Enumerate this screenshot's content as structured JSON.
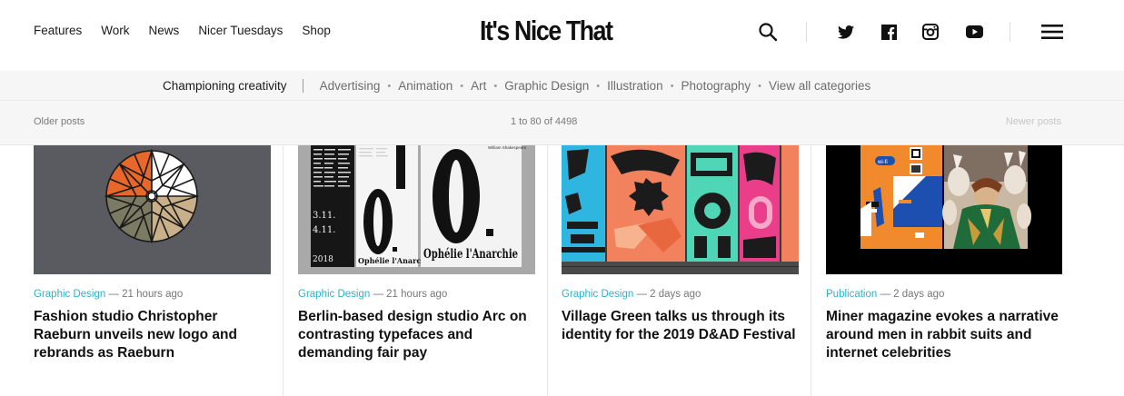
{
  "header": {
    "nav": [
      "Features",
      "Work",
      "News",
      "Nicer Tuesdays",
      "Shop"
    ],
    "logo": "It's Nice That",
    "icons": [
      "search-icon",
      "twitter-icon",
      "facebook-icon",
      "instagram-icon",
      "youtube-icon",
      "menu-icon"
    ]
  },
  "categories": {
    "tagline": "Championing creativity",
    "items": [
      "Advertising",
      "Animation",
      "Art",
      "Graphic Design",
      "Illustration",
      "Photography",
      "View all categories"
    ],
    "separator": "•"
  },
  "pagination": {
    "older": "Older posts",
    "count": "1 to 80 of 4498",
    "newer": "Newer posts"
  },
  "cards": [
    {
      "category": "Graphic Design",
      "time": "— 21 hours ago",
      "title": "Fashion studio Christopher Raeburn unveils new logo and rebrands as Raeburn"
    },
    {
      "category": "Graphic Design",
      "time": "— 21 hours ago",
      "title": "Berlin-based design studio Arc on contrasting typefaces and demanding fair pay"
    },
    {
      "category": "Graphic Design",
      "time": "— 2 days ago",
      "title": "Village Green talks us through its identity for the 2019 D&AD Festival"
    },
    {
      "category": "Publication",
      "time": "— 2 days ago",
      "title": "Miner magazine evokes a narrative around men in rabbit suits and internet celebrities"
    }
  ],
  "poster_text": {
    "author": "William Shakespeare",
    "title_right": "Ophélie l'Anarchie",
    "title_left": "Ophélie l'Anarchie",
    "dates": "3.11.",
    "dates2": "4.11.",
    "year": "2018",
    "letter": "O."
  },
  "magazine_text": {
    "badge": "wi-fi"
  },
  "colors": {
    "accent": "#2bb3c9",
    "text": "#111111",
    "muted": "#777777",
    "bar_bg": "#f6f6f6"
  }
}
